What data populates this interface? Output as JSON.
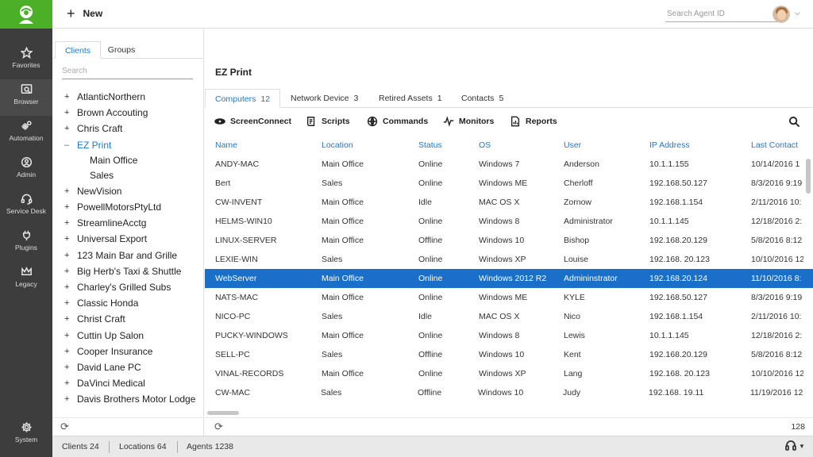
{
  "rail": {
    "items": [
      {
        "label": "Favorites",
        "icon": "star-icon"
      },
      {
        "label": "Browser",
        "icon": "browser-icon"
      },
      {
        "label": "Automation",
        "icon": "gears-icon"
      },
      {
        "label": "Admin",
        "icon": "admin-icon"
      },
      {
        "label": "Service Desk",
        "icon": "headset-icon"
      },
      {
        "label": "Plugins",
        "icon": "plug-icon"
      },
      {
        "label": "Legacy",
        "icon": "crown-icon"
      }
    ],
    "system_label": "System"
  },
  "topbar": {
    "new_label": "New",
    "search_placeholder": "Search Agent ID"
  },
  "left": {
    "tabs": [
      "Clients",
      "Groups"
    ],
    "search_placeholder": "Search",
    "tree": [
      {
        "label": "AtlanticNorthern",
        "toggle": "+"
      },
      {
        "label": "Brown Accouting",
        "toggle": "+"
      },
      {
        "label": "Chris Craft",
        "toggle": "+"
      },
      {
        "label": "EZ Print",
        "toggle": "–",
        "selected": true
      },
      {
        "label": "Main Office",
        "child": true
      },
      {
        "label": "Sales",
        "child": true
      },
      {
        "label": "NewVision",
        "toggle": "+"
      },
      {
        "label": "PowellMotorsPtyLtd",
        "toggle": "+"
      },
      {
        "label": "StreamlineAcctg",
        "toggle": "+"
      },
      {
        "label": "Universal Export",
        "toggle": "+"
      },
      {
        "label": "123 Main Bar and Grille",
        "toggle": "+"
      },
      {
        "label": "Big Herb's Taxi & Shuttle",
        "toggle": "+"
      },
      {
        "label": "Charley's Grilled Subs",
        "toggle": "+"
      },
      {
        "label": "Classic Honda",
        "toggle": "+"
      },
      {
        "label": "Christ Craft",
        "toggle": "+"
      },
      {
        "label": "Cuttin Up Salon",
        "toggle": "+"
      },
      {
        "label": "Cooper Insurance",
        "toggle": "+"
      },
      {
        "label": "David Lane PC",
        "toggle": "+"
      },
      {
        "label": "DaVinci Medical",
        "toggle": "+"
      },
      {
        "label": "Davis Brothers Motor Lodge",
        "toggle": "+"
      }
    ]
  },
  "main": {
    "title": "EZ Print",
    "tabs": [
      {
        "label": "Computers",
        "count": "12"
      },
      {
        "label": "Network Device",
        "count": "3"
      },
      {
        "label": "Retired Assets",
        "count": "1"
      },
      {
        "label": "Contacts",
        "count": "5"
      }
    ],
    "tools": [
      {
        "label": "ScreenConnect",
        "icon": "screenconnect-icon"
      },
      {
        "label": "Scripts",
        "icon": "scripts-icon"
      },
      {
        "label": "Commands",
        "icon": "commands-icon"
      },
      {
        "label": "Monitors",
        "icon": "pulse-icon"
      },
      {
        "label": "Reports",
        "icon": "reports-icon"
      }
    ],
    "columns": [
      "Name",
      "Location",
      "Status",
      "OS",
      "User",
      "IP Address",
      "Last Contact"
    ],
    "rows": [
      [
        "ANDY-MAC",
        "Main Office",
        "Online",
        "Windows 7",
        "Anderson",
        "10.1.1.155",
        "10/14/2016 1"
      ],
      [
        "Bert",
        "Sales",
        "Online",
        "Windows ME",
        "Cherloff",
        "192.168.50.127",
        "8/3/2016 9:19"
      ],
      [
        "CW-INVENT",
        "Main Office",
        "Idle",
        "MAC OS X",
        "Zornow",
        "192.168.1.154",
        "2/11/2016 10:"
      ],
      [
        "HELMS-WIN10",
        "Main Office",
        "Online",
        "Windows 8",
        "Administrator",
        "10.1.1.145",
        "12/18/2016 2:"
      ],
      [
        "LINUX-SERVER",
        "Main Office",
        "Offline",
        "Windows 10",
        "Bishop",
        "192.168.20.129",
        "5/8/2016 8:12"
      ],
      [
        "LEXIE-WIN",
        "Sales",
        "Online",
        "Windows XP",
        "Louise",
        "192.168. 20.123",
        "10/10/2016 12"
      ],
      [
        "WebServer",
        "Main Office",
        "Online",
        "Windows 2012 R2",
        "Admininstrator",
        "192.168.20.124",
        "11/10/2016 8:"
      ],
      [
        "NATS-MAC",
        "Main Office",
        "Online",
        "Windows ME",
        "KYLE",
        "192.168.50.127",
        "8/3/2016 9:19"
      ],
      [
        "NICO-PC",
        "Sales",
        "Idle",
        "MAC OS X",
        "Nico",
        "192.168.1.154",
        "2/11/2016 10:"
      ],
      [
        "PUCKY-WINDOWS",
        "Main Office",
        "Online",
        "Windows 8",
        "Lewis",
        "10.1.1.145",
        "12/18/2016 2:"
      ],
      [
        "SELL-PC",
        "Sales",
        "Offline",
        "Windows 10",
        "Kent",
        "192.168.20.129",
        "5/8/2016 8:12"
      ],
      [
        "VINAL-RECORDS",
        "Main Office",
        "Online",
        "Windows XP",
        "Lang",
        "192.168. 20.123",
        "10/10/2016 12"
      ],
      [
        "CW-MAC",
        "Sales",
        "Offline",
        "Windows 10",
        "Judy",
        "192.168. 19.11",
        "11/19/2016 12"
      ]
    ],
    "selected_row": 6,
    "total_count": "128"
  },
  "status": {
    "clients": "Clients 24",
    "locations": "Locations 64",
    "agents": "Agents 1238"
  },
  "colors": {
    "brand_green": "#4caf28",
    "accent_blue": "#1e78c8",
    "selected_row": "#1a6fc9",
    "rail_bg": "#3d3d3d"
  }
}
